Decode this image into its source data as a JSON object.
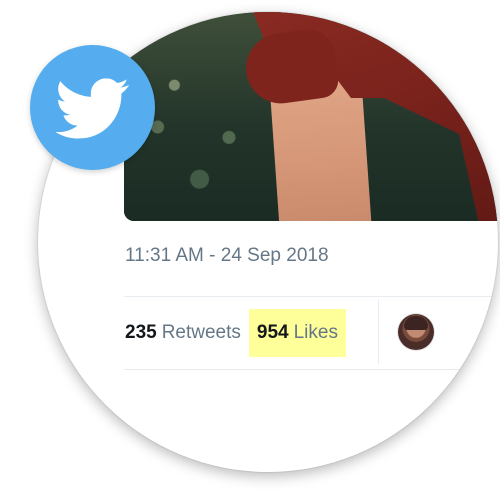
{
  "tweet": {
    "timestamp": "11:31 AM - 24 Sep 2018",
    "retweets": {
      "count": "235",
      "label": "Retweets"
    },
    "likes": {
      "count": "954",
      "label": "Likes",
      "highlight_color": "#ffff99"
    }
  },
  "badge": {
    "icon": "twitter-bird-icon",
    "color": "#55acee"
  },
  "colors": {
    "muted_text": "#657786",
    "strong_text": "#14171a",
    "divider": "#e6ecf0"
  }
}
